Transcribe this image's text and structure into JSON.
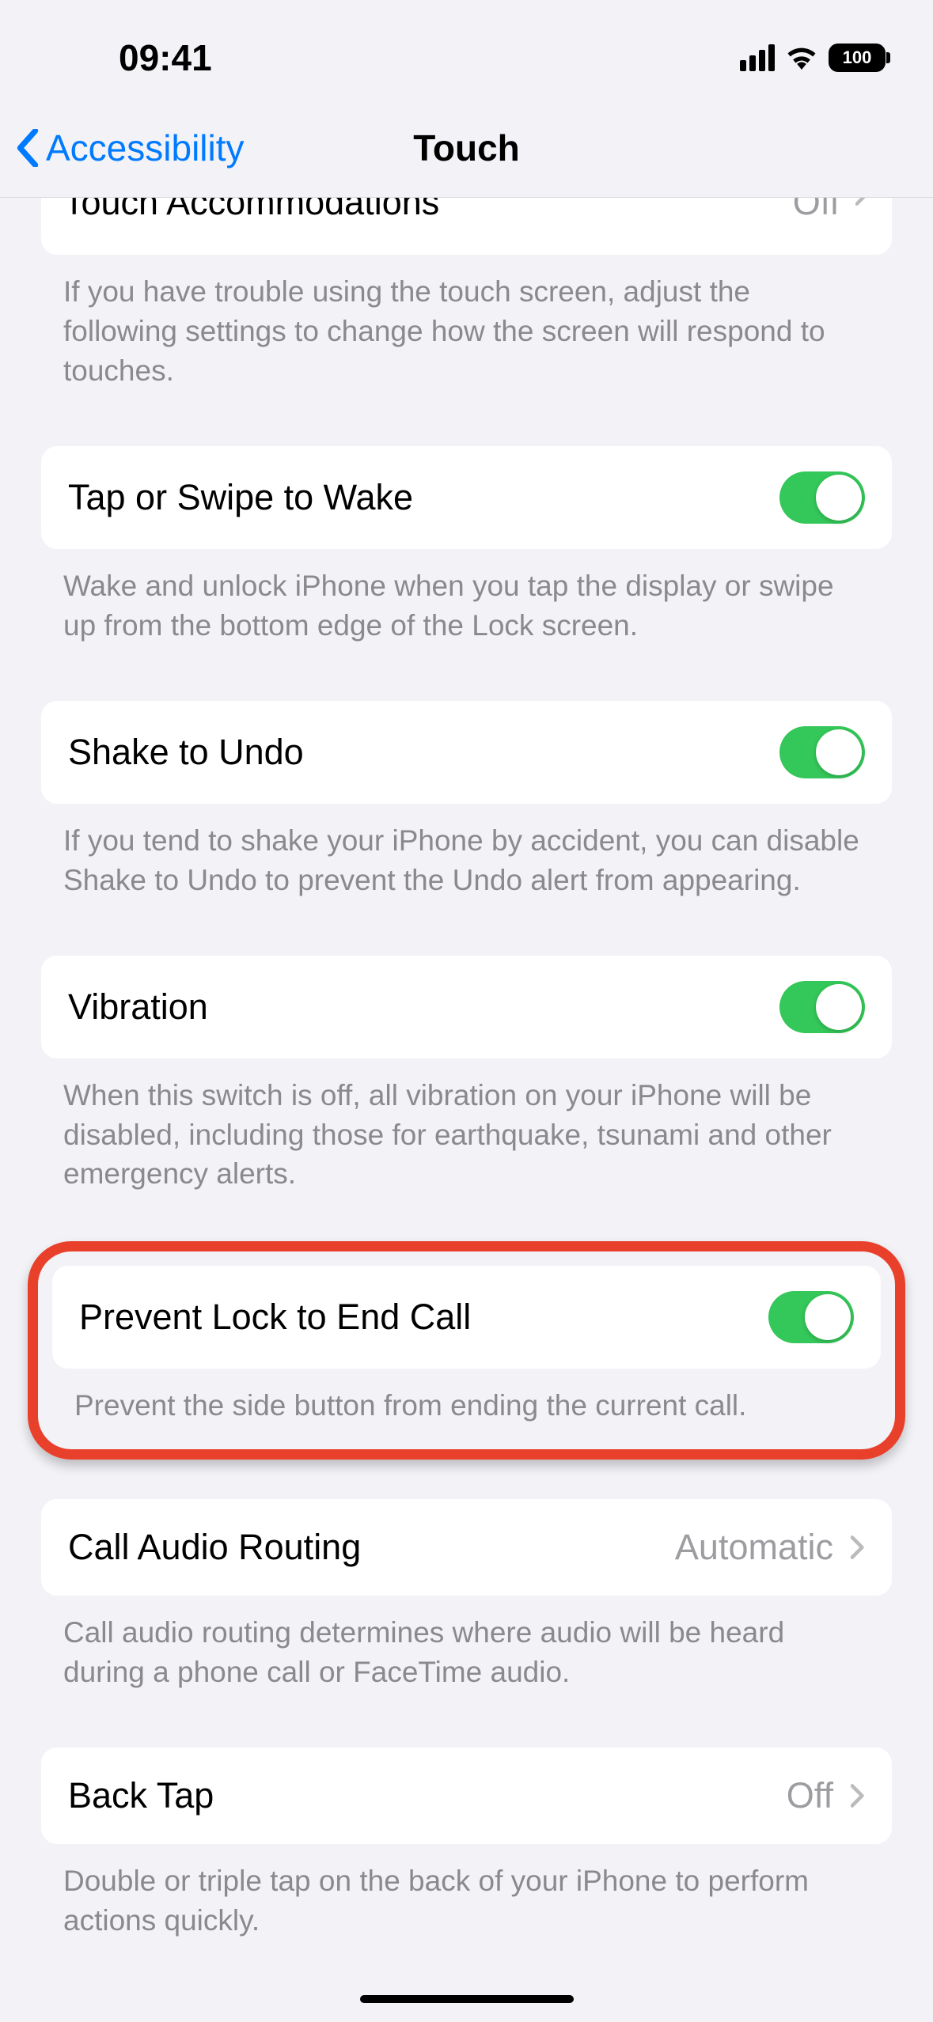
{
  "status_bar": {
    "time": "09:41",
    "battery_text": "100"
  },
  "nav": {
    "back_label": "Accessibility",
    "title": "Touch"
  },
  "partial_row": {
    "label": "Touch Accommodations",
    "value": "Off"
  },
  "sections": {
    "touch_accommodations_footer": "If you have trouble using the touch screen, adjust the following settings to change how the screen will respond to touches.",
    "tap_to_wake": {
      "label": "Tap or Swipe to Wake",
      "footer": "Wake and unlock iPhone when you tap the display or swipe up from the bottom edge of the Lock screen."
    },
    "shake_to_undo": {
      "label": "Shake to Undo",
      "footer": "If you tend to shake your iPhone by accident, you can disable Shake to Undo to prevent the Undo alert from appearing."
    },
    "vibration": {
      "label": "Vibration",
      "footer": "When this switch is off, all vibration on your iPhone will be disabled, including those for earthquake, tsunami and other emergency alerts."
    },
    "prevent_lock_end_call": {
      "label": "Prevent Lock to End Call",
      "footer": "Prevent the side button from ending the current call."
    },
    "call_audio_routing": {
      "label": "Call Audio Routing",
      "value": "Automatic",
      "footer": "Call audio routing determines where audio will be heard during a phone call or FaceTime audio."
    },
    "back_tap": {
      "label": "Back Tap",
      "value": "Off",
      "footer": "Double or triple tap on the back of your iPhone to perform actions quickly."
    }
  }
}
